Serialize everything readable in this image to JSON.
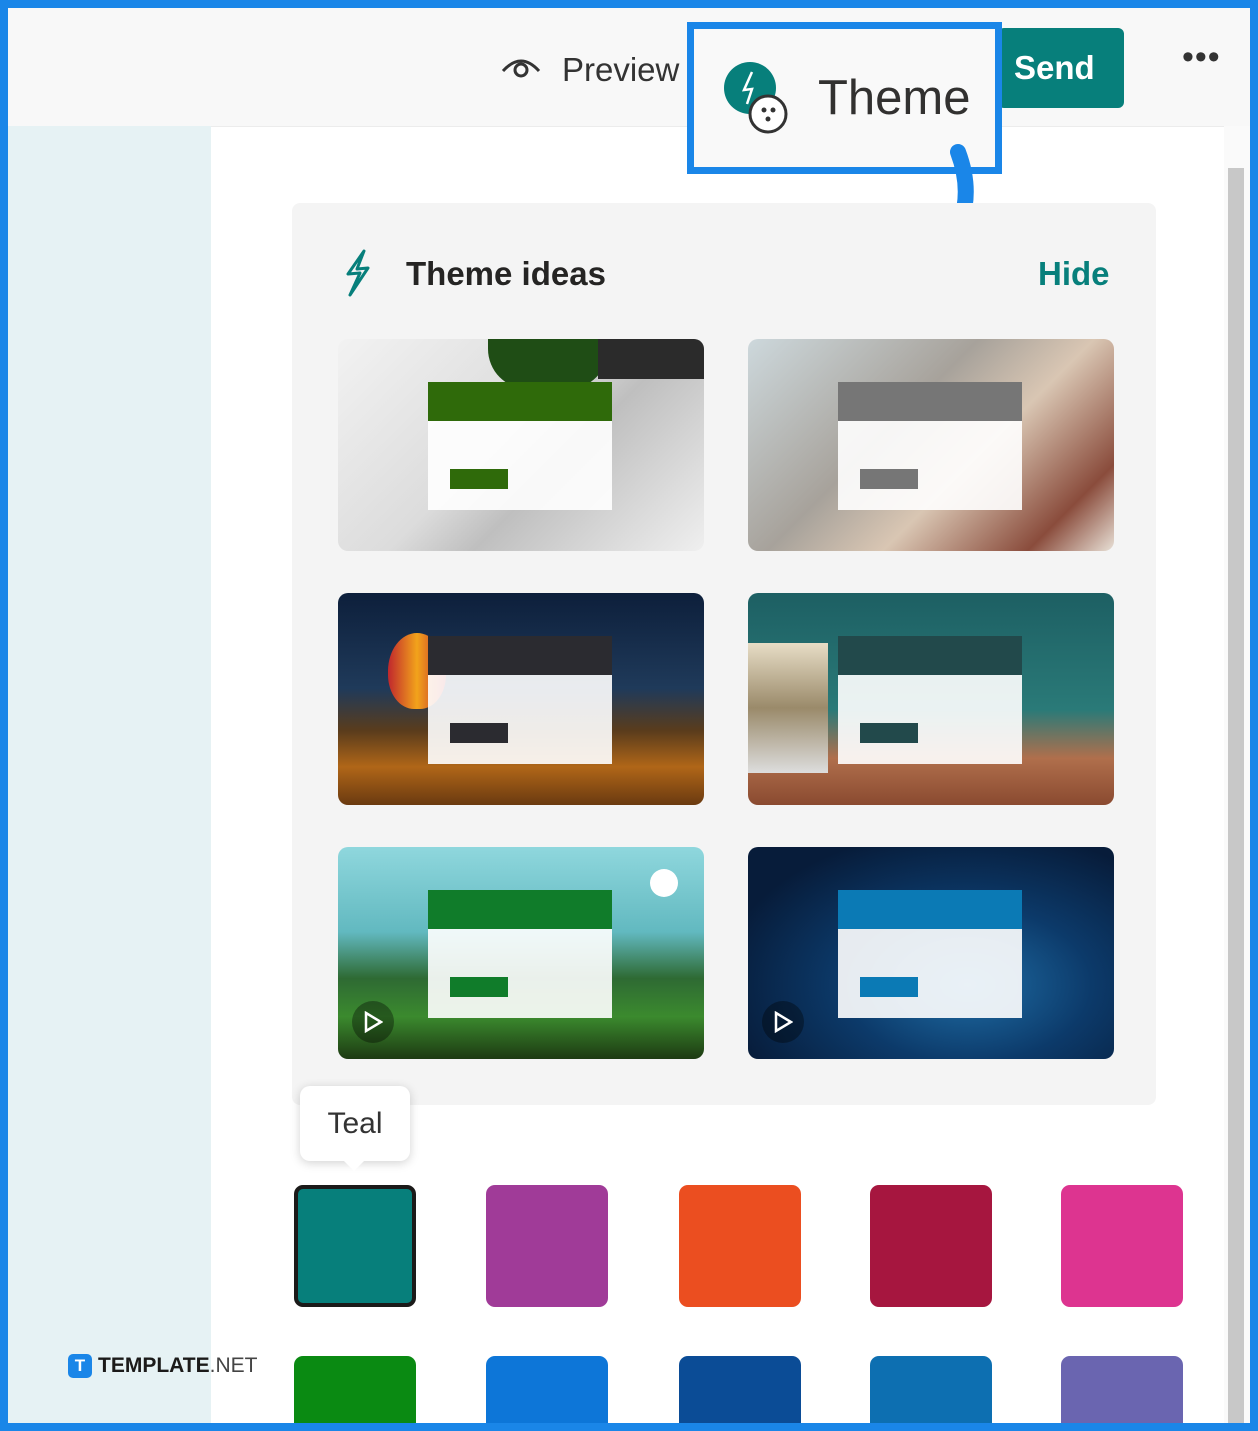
{
  "toolbar": {
    "preview_label": "Preview",
    "send_label": "Send",
    "more_label": "•••",
    "theme_label": "Theme"
  },
  "theme_ideas": {
    "title": "Theme ideas",
    "hide_label": "Hide",
    "tiles": [
      {
        "accent": "#2f6a0a",
        "bg": "light-desk-plant"
      },
      {
        "accent": "#767676",
        "bg": "art-studio-desk"
      },
      {
        "accent": "#2b2b30",
        "bg": "night-balloon-desert"
      },
      {
        "accent": "#22494b",
        "bg": "school-books-pencils"
      },
      {
        "accent": "#107c2a",
        "bg": "forest-meadow",
        "video": true
      },
      {
        "accent": "#0b7ab5",
        "bg": "digital-wave",
        "video": true
      }
    ]
  },
  "tooltip": {
    "text": "Teal"
  },
  "swatches": [
    {
      "name": "teal",
      "color": "#077f7b",
      "selected": true
    },
    {
      "name": "purple",
      "color": "#a03b98"
    },
    {
      "name": "orange",
      "color": "#eb4e20"
    },
    {
      "name": "crimson",
      "color": "#a6163f"
    },
    {
      "name": "pink",
      "color": "#dd3490"
    },
    {
      "name": "green",
      "color": "#0a8a12"
    },
    {
      "name": "blue",
      "color": "#0d76d8"
    },
    {
      "name": "navy",
      "color": "#0b4c96"
    },
    {
      "name": "ocean-blue",
      "color": "#0d6fb1"
    },
    {
      "name": "lavender",
      "color": "#6a65b0"
    }
  ],
  "brand": {
    "text_bold": "TEMPLATE",
    "text_light": ".NET",
    "logo_letter": "T"
  }
}
